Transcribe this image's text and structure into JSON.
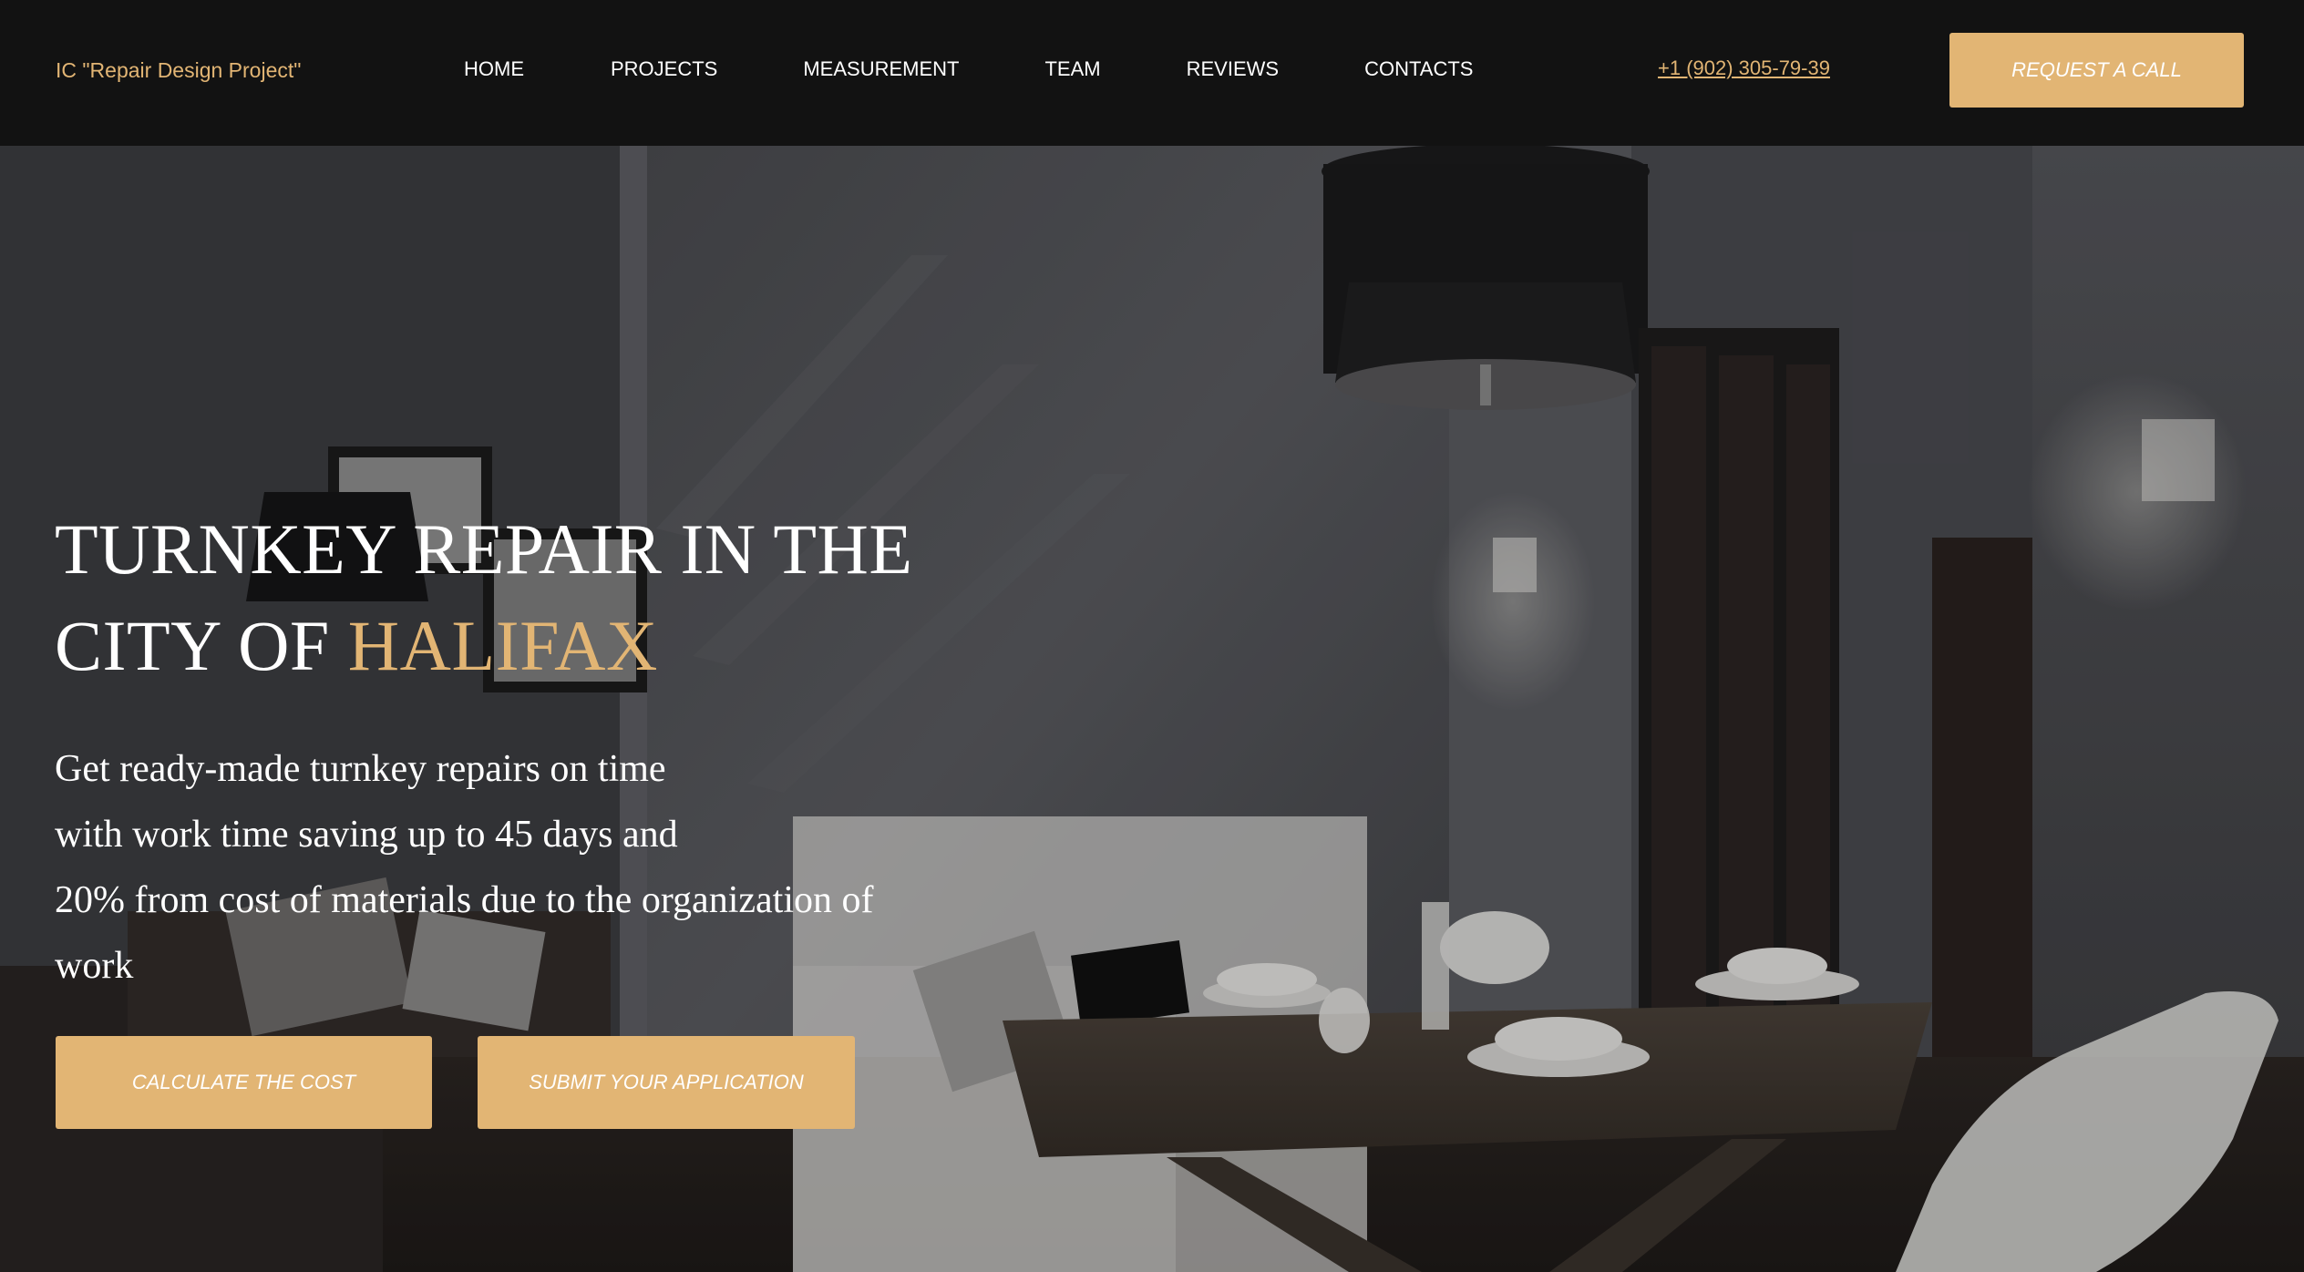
{
  "header": {
    "logo_text": "IC \"Repair Design Project\"",
    "nav": [
      {
        "label": "HOME"
      },
      {
        "label": "PROJECTS"
      },
      {
        "label": "MEASUREMENT"
      },
      {
        "label": "TEAM"
      },
      {
        "label": "REVIEWS"
      },
      {
        "label": "CONTACTS"
      }
    ],
    "phone": "+1 (902) 305-79-39",
    "request_call_label": "REQUEST A CALL"
  },
  "hero": {
    "title_line1": "TURNKEY REPAIR IN THE",
    "title_line2_prefix": "CITY OF ",
    "title_accent": "HALIFAX",
    "subtitle_lines": [
      "Get ready-made turnkey repairs on time",
      "with work time saving up to 45 days and",
      "20% from cost of materials due to the organization of",
      "work"
    ],
    "calculate_label": "CALCULATE THE COST",
    "submit_label": "SUBMIT YOUR APPLICATION",
    "background_icon": "interior-photo"
  },
  "colors": {
    "accent": "#e2b574",
    "header_bg": "#121212",
    "text": "#ffffff"
  }
}
